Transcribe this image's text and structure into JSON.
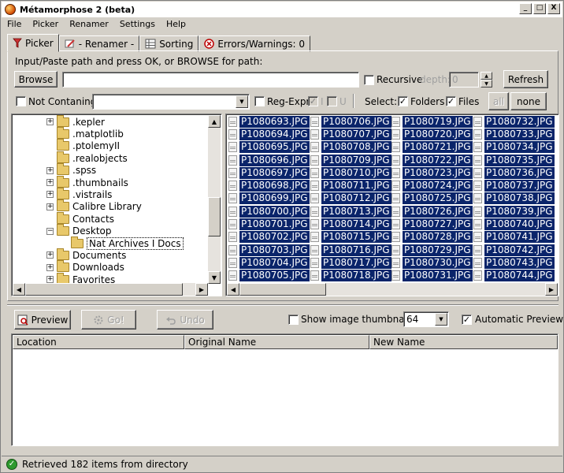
{
  "window": {
    "title": "Métamorphose 2 (beta)",
    "controls": [
      "_",
      "□",
      "X"
    ]
  },
  "menu": [
    "File",
    "Picker",
    "Renamer",
    "Settings",
    "Help"
  ],
  "tabs": [
    {
      "label": "Picker",
      "icon": "funnel-icon",
      "active": true
    },
    {
      "label": "- Renamer -",
      "icon": "renamer-icon",
      "active": false
    },
    {
      "label": "Sorting",
      "icon": "sorting-icon",
      "active": false
    },
    {
      "label": "Errors/Warnings: 0",
      "icon": "error-icon",
      "active": false
    }
  ],
  "picker": {
    "path_instruction": "Input/Paste path and press OK, or BROWSE for path:",
    "browse_label": "Browse",
    "path_value": "",
    "recursive_label": "Recursive",
    "recursive_checked": false,
    "depth_label": "depth:",
    "depth_value": "0",
    "refresh_label": "Refresh",
    "not_containing_label": "Not Contaning:",
    "not_containing_checked": false,
    "not_containing_value": "",
    "regexpr_label": "Reg-Expr",
    "regexpr_checked": false,
    "i_label": "I",
    "i_checked": true,
    "u_label": "U",
    "u_checked": false,
    "select_label": "Select:",
    "folders_label": "Folders",
    "folders_checked": true,
    "files_label": "Files",
    "files_checked": true,
    "all_label": "all",
    "none_label": "none"
  },
  "tree": [
    {
      "label": ".kepler",
      "expander": true
    },
    {
      "label": ".matplotlib",
      "expander": false
    },
    {
      "label": ".ptolemyII",
      "expander": false
    },
    {
      "label": ".realobjects",
      "expander": false
    },
    {
      "label": ".spss",
      "expander": true
    },
    {
      "label": ".thumbnails",
      "expander": true
    },
    {
      "label": ".vistrails",
      "expander": true
    },
    {
      "label": "Calibre Library",
      "expander": true
    },
    {
      "label": "Contacts",
      "expander": false
    },
    {
      "label": "Desktop",
      "expander": "minus"
    },
    {
      "label": "Nat Archives I Docs",
      "expander": false,
      "indent": true,
      "selected": true
    },
    {
      "label": "Documents",
      "expander": true
    },
    {
      "label": "Downloads",
      "expander": true
    },
    {
      "label": "Favorites",
      "expander": true
    }
  ],
  "files": [
    [
      "P1080693.JPG",
      "P1080694.JPG",
      "P1080695.JPG",
      "P1080696.JPG",
      "P1080697.JPG",
      "P1080698.JPG",
      "P1080699.JPG",
      "P1080700.JPG",
      "P1080701.JPG",
      "P1080702.JPG",
      "P1080703.JPG",
      "P1080704.JPG",
      "P1080705.JPG"
    ],
    [
      "P1080706.JPG",
      "P1080707.JPG",
      "P1080708.JPG",
      "P1080709.JPG",
      "P1080710.JPG",
      "P1080711.JPG",
      "P1080712.JPG",
      "P1080713.JPG",
      "P1080714.JPG",
      "P1080715.JPG",
      "P1080716.JPG",
      "P1080717.JPG",
      "P1080718.JPG"
    ],
    [
      "P1080719.JPG",
      "P1080720.JPG",
      "P1080721.JPG",
      "P1080722.JPG",
      "P1080723.JPG",
      "P1080724.JPG",
      "P1080725.JPG",
      "P1080726.JPG",
      "P1080727.JPG",
      "P1080728.JPG",
      "P1080729.JPG",
      "P1080730.JPG",
      "P1080731.JPG"
    ],
    [
      "P1080732.JPG",
      "P1080733.JPG",
      "P1080734.JPG",
      "P1080735.JPG",
      "P1080736.JPG",
      "P1080737.JPG",
      "P1080738.JPG",
      "P1080739.JPG",
      "P1080740.JPG",
      "P1080741.JPG",
      "P1080742.JPG",
      "P1080743.JPG",
      "P1080744.JPG"
    ]
  ],
  "actions": {
    "preview_label": "Preview",
    "go_label": "Go!",
    "undo_label": "Undo",
    "thumbnails_label": "Show image thumbnails",
    "thumbnails_checked": false,
    "thumb_size": "64",
    "auto_preview_label": "Automatic Preview",
    "auto_preview_checked": true
  },
  "preview_table": {
    "columns": [
      "Location",
      "Original Name",
      "New Name"
    ]
  },
  "status": {
    "text": "Retrieved 182 items from directory"
  },
  "colors": {
    "selection": "#0a246a",
    "face": "#d4d0c8",
    "ok": "#2e9a2e"
  }
}
